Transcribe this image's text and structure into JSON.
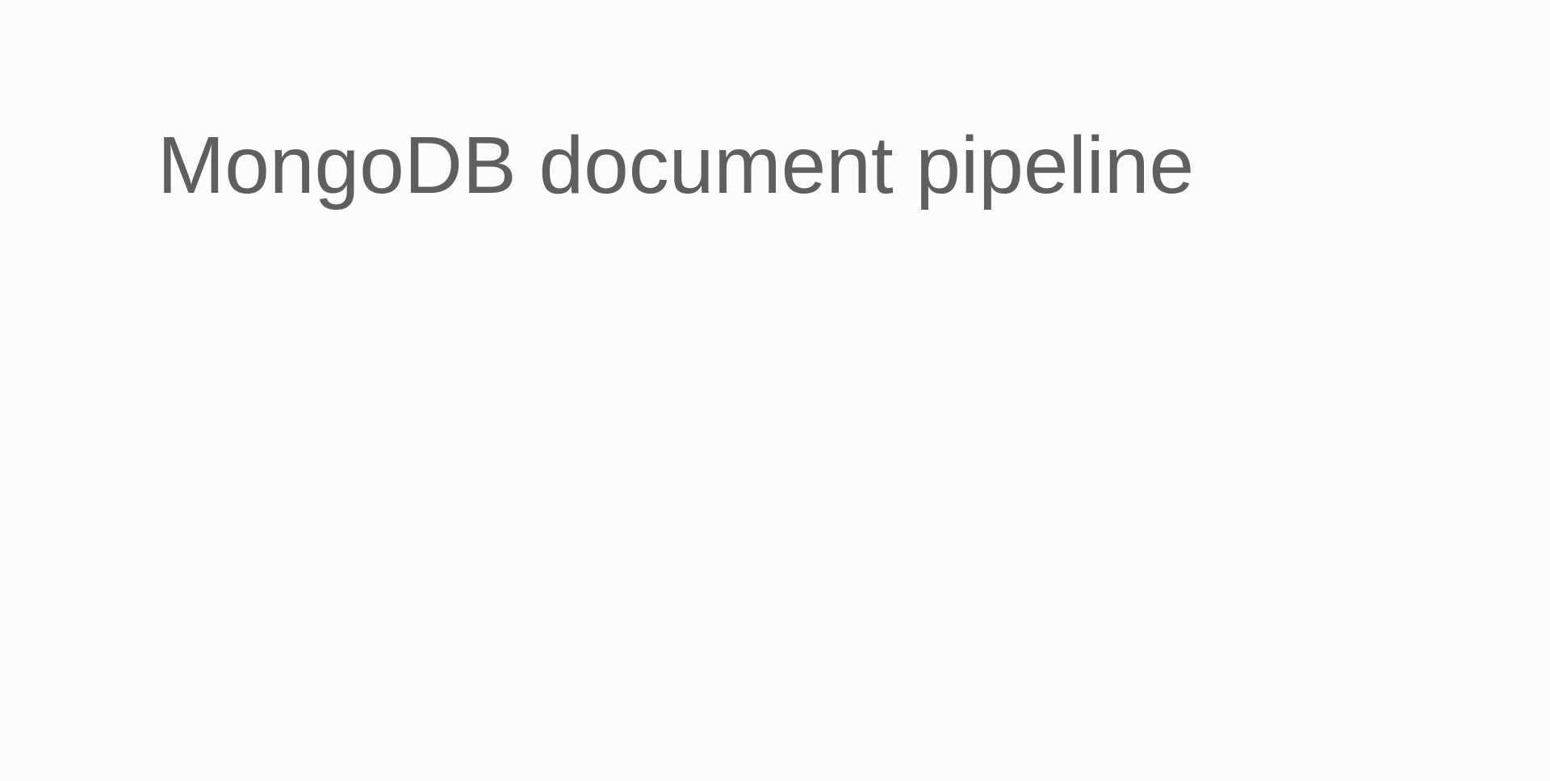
{
  "slide": {
    "title": "MongoDB document pipeline"
  }
}
